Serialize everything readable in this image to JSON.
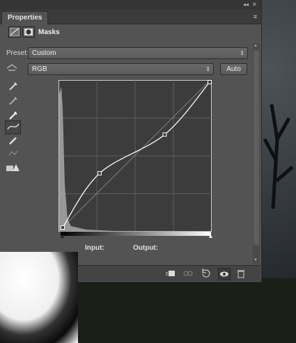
{
  "panel": {
    "tab_label": "Properties",
    "window_controls": {
      "collapse": "◂◂",
      "close": "✕"
    },
    "menu_icon": "≡"
  },
  "header": {
    "title": "Masks"
  },
  "preset": {
    "label": "Preset:",
    "value": "Custom"
  },
  "channel": {
    "value": "RGB",
    "auto_label": "Auto"
  },
  "tools": [
    "hand-target-icon",
    "eyedropper-black-icon",
    "eyedropper-gray-icon",
    "eyedropper-white-icon",
    "curve-point-icon",
    "pencil-icon",
    "smooth-icon",
    "clipping-warning-icon"
  ],
  "curve": {
    "input_label": "Input:",
    "output_label": "Output:",
    "points": [
      [
        0,
        0
      ],
      [
        64,
        95
      ],
      [
        177,
        163
      ],
      [
        255,
        255
      ]
    ]
  },
  "footer": {
    "icons": [
      "clip-to-layer-icon",
      "link-icon",
      "reset-icon",
      "visibility-eye-icon",
      "trash-icon"
    ]
  },
  "colors": {
    "panel": "#535353",
    "graph_bg": "#3c3c3c",
    "accent": "#ffffff"
  }
}
